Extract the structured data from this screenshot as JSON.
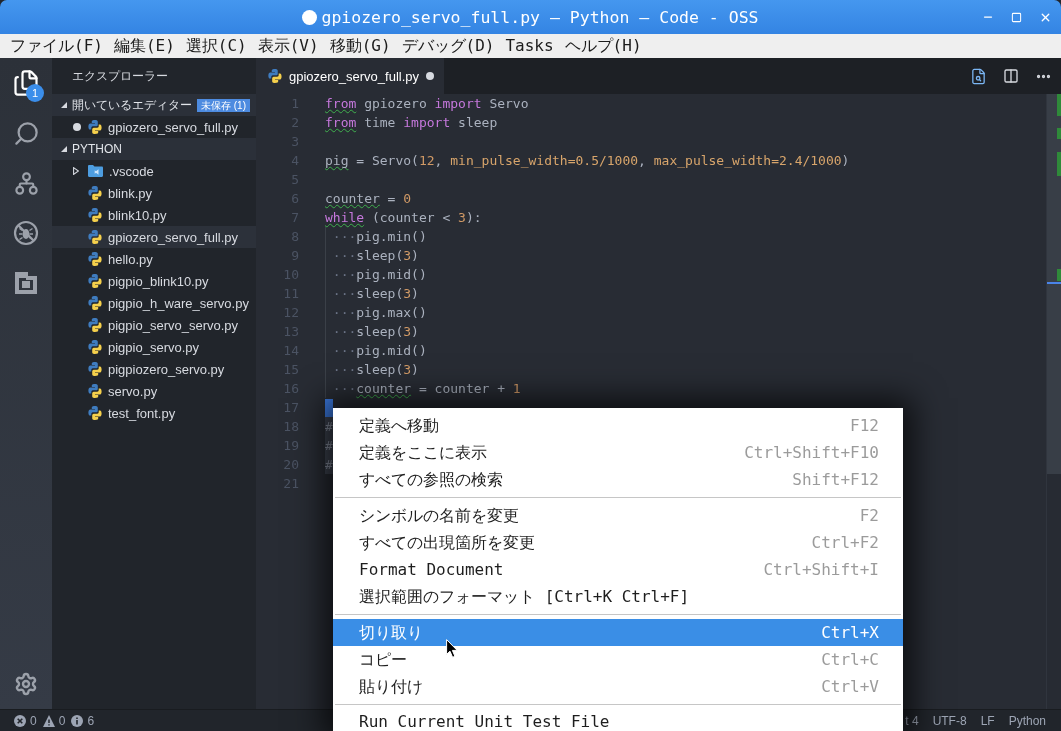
{
  "window": {
    "title": "gpiozero_servo_full.py — Python — Code - OSS",
    "dirty": true
  },
  "menu_bar": [
    "ファイル(F)",
    "編集(E)",
    "選択(C)",
    "表示(V)",
    "移動(G)",
    "デバッグ(D)",
    "Tasks",
    "ヘルプ(H)"
  ],
  "activity_bar": {
    "items": [
      {
        "kind": "explorer",
        "selected": true,
        "badge": "1"
      },
      {
        "kind": "search",
        "selected": false
      },
      {
        "kind": "source_control",
        "selected": false
      },
      {
        "kind": "debug",
        "selected": false
      },
      {
        "kind": "extensions",
        "selected": false
      }
    ]
  },
  "sidebar": {
    "title": "エクスプローラー",
    "open_editors": {
      "label": "開いているエディター",
      "expanded": true,
      "badge": "未保存 (1)",
      "items": [
        {
          "name": "gpiozero_servo_full.py",
          "dirty": true
        }
      ]
    },
    "folder": {
      "label": "PYTHON",
      "expanded": true,
      "items": [
        {
          "name": ".vscode",
          "kind": "folder",
          "expanded": false,
          "selected": false
        },
        {
          "name": "blink.py",
          "kind": "file",
          "selected": false
        },
        {
          "name": "blink10.py",
          "kind": "file",
          "selected": false
        },
        {
          "name": "gpiozero_servo_full.py",
          "kind": "file",
          "selected": true
        },
        {
          "name": "hello.py",
          "kind": "file",
          "selected": false
        },
        {
          "name": "pigpio_blink10.py",
          "kind": "file",
          "selected": false
        },
        {
          "name": "pigpio_h_ware_servo.py",
          "kind": "file",
          "selected": false
        },
        {
          "name": "pigpio_servo_servo.py",
          "kind": "file",
          "selected": false
        },
        {
          "name": "pigpio_servo.py",
          "kind": "file",
          "selected": false
        },
        {
          "name": "pigpiozero_servo.py",
          "kind": "file",
          "selected": false
        },
        {
          "name": "servo.py",
          "kind": "file",
          "selected": false
        },
        {
          "name": "test_font.py",
          "kind": "file",
          "selected": false
        }
      ]
    }
  },
  "editor": {
    "tabs": [
      {
        "label": "gpiozero_servo_full.py",
        "selected": true,
        "dirty": true
      }
    ],
    "lines": [
      {
        "number": "1",
        "selected": false,
        "tokens": [
          {
            "kind": "keyword",
            "text": "from",
            "squiggle": true
          },
          {
            "kind": "plain",
            "text": " gpiozero ",
            "squiggle": false
          },
          {
            "kind": "keyword",
            "text": "import",
            "squiggle": false
          },
          {
            "kind": "plain",
            "text": " Servo",
            "squiggle": false
          }
        ]
      },
      {
        "number": "2",
        "selected": false,
        "tokens": [
          {
            "kind": "keyword",
            "text": "from",
            "squiggle": true
          },
          {
            "kind": "plain",
            "text": " time ",
            "squiggle": false
          },
          {
            "kind": "keyword",
            "text": "import",
            "squiggle": false
          },
          {
            "kind": "plain",
            "text": " sleep",
            "squiggle": false
          }
        ]
      },
      {
        "number": "3",
        "selected": false
      },
      {
        "number": "4",
        "selected": false,
        "tokens": [
          {
            "kind": "plain",
            "text": "pig",
            "squiggle": true
          },
          {
            "kind": "plain",
            "text": " = Servo(",
            "squiggle": false
          },
          {
            "kind": "number",
            "text": "12",
            "squiggle": false
          },
          {
            "kind": "plain",
            "text": ", ",
            "squiggle": false
          },
          {
            "kind": "param",
            "text": "min_pulse_width=0.5/1000",
            "squiggle": false
          },
          {
            "kind": "plain",
            "text": ", ",
            "squiggle": false
          },
          {
            "kind": "param",
            "text": "max_pulse_width=2.4/1000",
            "squiggle": false
          },
          {
            "kind": "plain",
            "text": ")",
            "squiggle": false
          }
        ]
      },
      {
        "number": "5",
        "selected": false
      },
      {
        "number": "6",
        "selected": false,
        "tokens": [
          {
            "kind": "plain",
            "text": "counter",
            "squiggle": true
          },
          {
            "kind": "plain",
            "text": " = ",
            "squiggle": false
          },
          {
            "kind": "number",
            "text": "0",
            "squiggle": false
          }
        ]
      },
      {
        "number": "7",
        "selected": false,
        "tokens": [
          {
            "kind": "keyword",
            "text": "while",
            "squiggle": true
          },
          {
            "kind": "plain",
            "text": " (counter < ",
            "squiggle": false
          },
          {
            "kind": "number",
            "text": "3",
            "squiggle": false
          },
          {
            "kind": "plain",
            "text": "):",
            "squiggle": false
          }
        ]
      },
      {
        "number": "8",
        "selected": false,
        "tokens": [
          {
            "kind": "indent",
            "text": "···",
            "squiggle": false
          },
          {
            "kind": "plain",
            "text": "pig.min()",
            "squiggle": false
          }
        ]
      },
      {
        "number": "9",
        "selected": false,
        "tokens": [
          {
            "kind": "indent",
            "text": "···",
            "squiggle": false
          },
          {
            "kind": "plain",
            "text": "sleep(",
            "squiggle": false
          },
          {
            "kind": "number",
            "text": "3",
            "squiggle": false
          },
          {
            "kind": "plain",
            "text": ")",
            "squiggle": false
          }
        ]
      },
      {
        "number": "10",
        "selected": false,
        "tokens": [
          {
            "kind": "indent",
            "text": "···",
            "squiggle": false
          },
          {
            "kind": "plain",
            "text": "pig.mid()",
            "squiggle": false
          }
        ]
      },
      {
        "number": "11",
        "selected": false,
        "tokens": [
          {
            "kind": "indent",
            "text": "···",
            "squiggle": false
          },
          {
            "kind": "plain",
            "text": "sleep(",
            "squiggle": false
          },
          {
            "kind": "number",
            "text": "3",
            "squiggle": false
          },
          {
            "kind": "plain",
            "text": ")",
            "squiggle": false
          }
        ]
      },
      {
        "number": "12",
        "selected": false,
        "tokens": [
          {
            "kind": "indent",
            "text": "···",
            "squiggle": false
          },
          {
            "kind": "plain",
            "text": "pig.max()",
            "squiggle": false
          }
        ]
      },
      {
        "number": "13",
        "selected": false,
        "tokens": [
          {
            "kind": "indent",
            "text": "···",
            "squiggle": false
          },
          {
            "kind": "plain",
            "text": "sleep(",
            "squiggle": false
          },
          {
            "kind": "number",
            "text": "3",
            "squiggle": false
          },
          {
            "kind": "plain",
            "text": ")",
            "squiggle": false
          }
        ]
      },
      {
        "number": "14",
        "selected": false,
        "tokens": [
          {
            "kind": "indent",
            "text": "···",
            "squiggle": false
          },
          {
            "kind": "plain",
            "text": "pig.mid()",
            "squiggle": false
          }
        ]
      },
      {
        "number": "15",
        "selected": false,
        "tokens": [
          {
            "kind": "indent",
            "text": "···",
            "squiggle": false
          },
          {
            "kind": "plain",
            "text": "sleep(",
            "squiggle": false
          },
          {
            "kind": "number",
            "text": "3",
            "squiggle": false
          },
          {
            "kind": "plain",
            "text": ")",
            "squiggle": false
          }
        ]
      },
      {
        "number": "16",
        "selected": false,
        "tokens": [
          {
            "kind": "indent",
            "text": "···",
            "squiggle": false
          },
          {
            "kind": "plain",
            "text": "counter",
            "squiggle": true
          },
          {
            "kind": "plain",
            "text": " = counter + ",
            "squiggle": false
          },
          {
            "kind": "number",
            "text": "1",
            "squiggle": false
          }
        ]
      },
      {
        "number": "17",
        "selected": false,
        "tokens": [
          {
            "kind": "cursor"
          }
        ]
      },
      {
        "number": "18",
        "selected": true,
        "tokens": [
          {
            "kind": "comment",
            "text": "#",
            "squiggle": false
          }
        ]
      },
      {
        "number": "19",
        "selected": true,
        "tokens": [
          {
            "kind": "comment",
            "text": "#",
            "squiggle": false
          }
        ]
      },
      {
        "number": "20",
        "selected": true,
        "tokens": [
          {
            "kind": "comment",
            "text": "#",
            "squiggle": false
          }
        ]
      },
      {
        "number": "21",
        "selected": false
      }
    ]
  },
  "context_menu": {
    "groups": [
      {
        "items": [
          {
            "label": "定義へ移動",
            "shortcut": "F12",
            "selected": false
          },
          {
            "label": "定義をここに表示",
            "shortcut": "Ctrl+Shift+F10",
            "selected": false
          },
          {
            "label": "すべての参照の検索",
            "shortcut": "Shift+F12",
            "selected": false
          }
        ]
      },
      {
        "items": [
          {
            "label": "シンボルの名前を変更",
            "shortcut": "F2",
            "selected": false
          },
          {
            "label": "すべての出現箇所を変更",
            "shortcut": "Ctrl+F2",
            "selected": false
          },
          {
            "label": "Format Document",
            "shortcut": "Ctrl+Shift+I",
            "selected": false
          },
          {
            "label": "選択範囲のフォーマット [Ctrl+K Ctrl+F]",
            "selected": false
          }
        ]
      },
      {
        "items": [
          {
            "label": "切り取り",
            "shortcut": "Ctrl+X",
            "selected": true
          },
          {
            "label": "コピー",
            "shortcut": "Ctrl+C",
            "selected": false
          },
          {
            "label": "貼り付け",
            "shortcut": "Ctrl+V",
            "selected": false
          }
        ]
      },
      {
        "items": [
          {
            "label": "Run Current Unit Test File",
            "selected": false
          }
        ]
      }
    ]
  },
  "status_bar": {
    "errors": "0",
    "warnings": "0",
    "infos": "6",
    "items": [
      "t 4",
      "UTF-8",
      "LF",
      "Python"
    ]
  }
}
